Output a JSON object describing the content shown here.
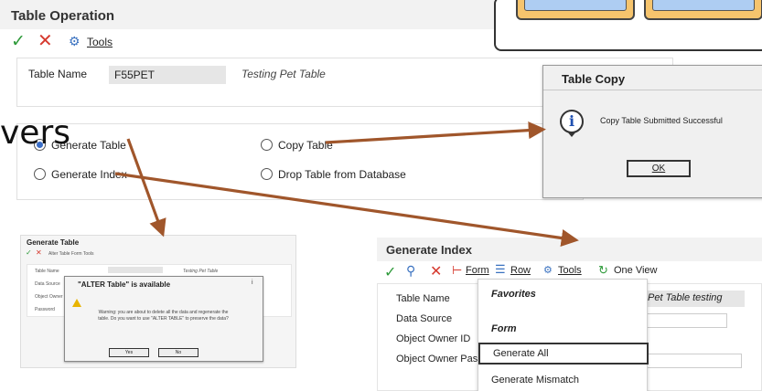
{
  "main_window": {
    "title": "Table Operation",
    "toolbar": {
      "ok_icon": "✓",
      "cancel_icon": "✕",
      "gear_icon": "⚙",
      "tools_label": "Tools"
    },
    "table_name_label": "Table Name",
    "table_name_value": "F55PET",
    "table_description": "Testing Pet Table",
    "options": {
      "generate_table": "Generate Table",
      "copy_table": "Copy Table",
      "generate_index": "Generate Index",
      "drop_table": "Drop Table from Database"
    },
    "selected_option": "generate_table"
  },
  "overlay_text": "vers",
  "table_copy_dialog": {
    "title": "Table Copy",
    "info_icon": "i",
    "message": "Copy Table Submitted Successful",
    "ok_label": "OK"
  },
  "generate_table_window": {
    "title": "Generate Table",
    "toolbar_text": "Alter Table    Form    Tools",
    "labels": [
      "Table Name",
      "Data Source",
      "Object Owner",
      "Password"
    ],
    "desc_text": "Testing Pet Table",
    "alter_dialog": {
      "title": "\"ALTER Table\" is available",
      "close_icon": "i",
      "message": "Warning: you are about to delete all the data and regenerate the table. Do you want to use \"ALTER TABLE\" to preserve the data?",
      "yes_label": "Yes",
      "no_label": "No"
    }
  },
  "generate_index_window": {
    "title": "Generate Index",
    "toolbar": {
      "ok_icon": "✓",
      "search_icon": "🔍",
      "cancel_icon": "✕",
      "form_label": "Form",
      "row_label": "Row",
      "tools_label": "Tools",
      "one_view_label": "One View"
    },
    "labels": {
      "table_name": "Table Name",
      "data_source": "Data Source",
      "object_owner_id": "Object Owner ID",
      "object_owner_password": "Object Owner Pass"
    },
    "table_name_value": "Pet Table testing",
    "form_menu": {
      "favorites": "Favorites",
      "form": "Form",
      "generate_all": "Generate All",
      "generate_mismatch": "Generate Mismatch"
    }
  },
  "colors": {
    "arrow": "#a0562b",
    "check": "#2e9a3a",
    "cancel": "#d63a2f",
    "radio_selected": "#3a6ec8"
  }
}
